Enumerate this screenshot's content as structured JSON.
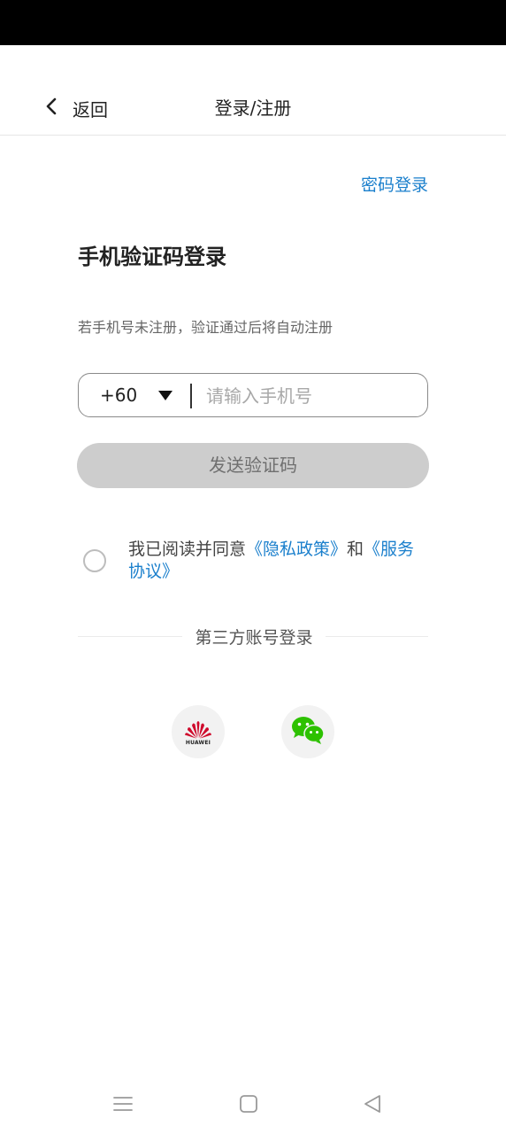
{
  "nav": {
    "back_label": "返回",
    "title": "登录/注册"
  },
  "login": {
    "password_login": "密码登录",
    "heading": "手机验证码登录",
    "hint": "若手机号未注册，验证通过后将自动注册",
    "country_code": "+60",
    "phone_placeholder": "请输入手机号",
    "phone_value": "",
    "send_code": "发送验证码"
  },
  "agreement": {
    "prefix": "我已阅读并同意",
    "privacy": "《隐私政策》",
    "and": "和",
    "service": "《服务协议》",
    "checked": false
  },
  "third_party": {
    "title": "第三方账号登录",
    "huawei_text": "HUAWEI",
    "providers": [
      "huawei",
      "wechat"
    ]
  },
  "colors": {
    "link": "#1a7fcc",
    "button_disabled": "#cdcdcd",
    "wechat_green": "#2dc100",
    "huawei_red": "#cf0a2c"
  }
}
